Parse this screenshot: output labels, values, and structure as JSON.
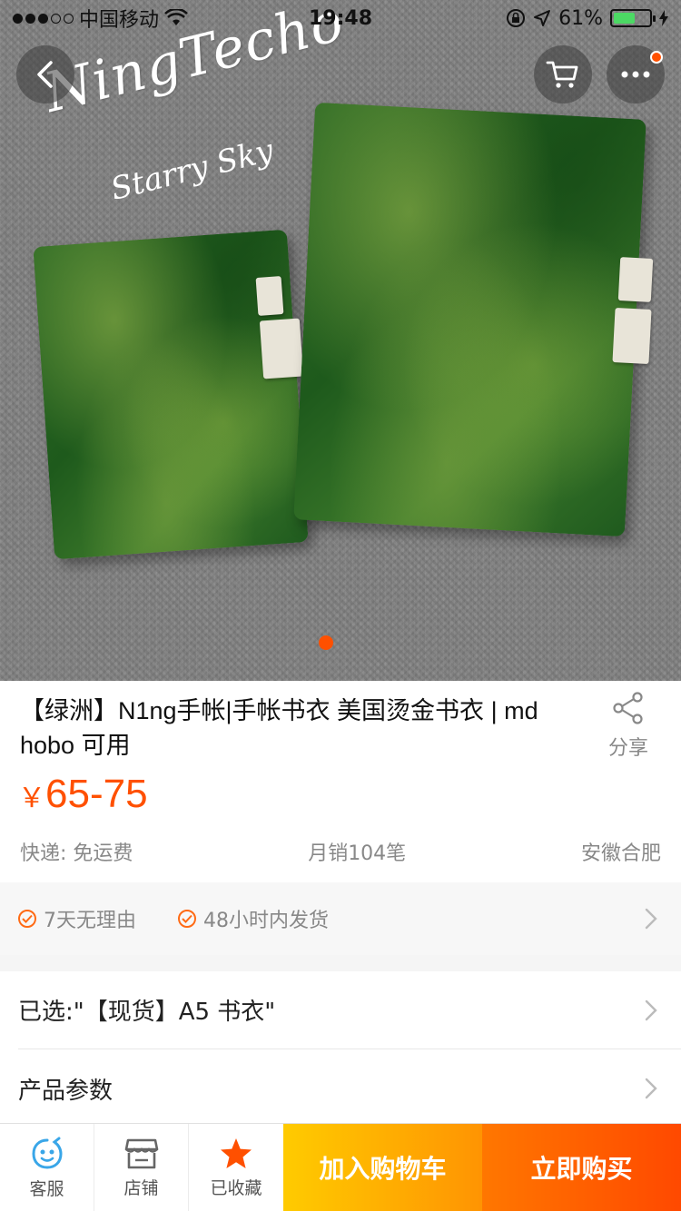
{
  "status_bar": {
    "carrier": "中国移动",
    "time": "19:48",
    "battery": "61%",
    "battery_level": 0.61
  },
  "hero": {
    "brand_line_1": "NingTecho",
    "brand_line_2": "Starry Sky",
    "slide_count": 1,
    "active_slide": 1
  },
  "product": {
    "title": "【绿洲】N1ng手帐|手帐书衣 美国烫金书衣 | md hobo 可用",
    "share_label": "分享",
    "price_currency": "￥",
    "price_range": "65-75",
    "shipping": "快递: 免运费",
    "monthly_sales": "月销104笔",
    "location": "安徽合肥"
  },
  "guarantees": [
    {
      "label": "7天无理由"
    },
    {
      "label": "48小时内发货"
    }
  ],
  "options": {
    "selected": "已选:\"【现货】A5 书衣\"",
    "params": "产品参数"
  },
  "bottom_bar": {
    "service": "客服",
    "shop": "店铺",
    "favorited": "已收藏",
    "add_to_cart": "加入购物车",
    "buy_now": "立即购买"
  },
  "colors": {
    "accent": "#ff5000",
    "cart_button": "#ff9402",
    "buy_button": "#ff4900",
    "service_icon": "#39a6e8"
  }
}
